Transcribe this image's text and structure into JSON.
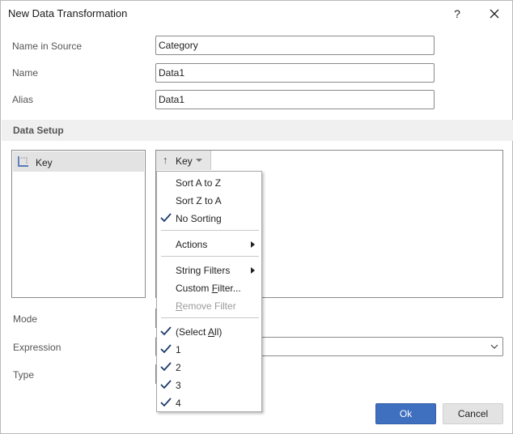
{
  "window": {
    "title": "New Data Transformation",
    "help_glyph": "?"
  },
  "fields": {
    "name_in_source": {
      "label": "Name in Source",
      "value": "Category"
    },
    "name": {
      "label": "Name",
      "value": "Data1"
    },
    "alias": {
      "label": "Alias",
      "value": "Data1"
    }
  },
  "section": {
    "title": "Data Setup"
  },
  "list": {
    "items": [
      {
        "label": "Key",
        "icon": "dimension-icon"
      }
    ]
  },
  "grid": {
    "column_header": "Key",
    "sort_arrow": "↑"
  },
  "menu": {
    "sort_asc": "Sort A to Z",
    "sort_desc": "Sort Z to A",
    "no_sorting": "No Sorting",
    "actions": "Actions",
    "string_filters": "String Filters",
    "custom_filter_pre": "Custom ",
    "custom_filter_u": "F",
    "custom_filter_post": "ilter...",
    "remove_filter_u": "R",
    "remove_filter_post": "emove Filter",
    "select_all_pre": "(Select ",
    "select_all_u": "A",
    "select_all_post": "ll)",
    "values": [
      "1",
      "2",
      "3",
      "4"
    ]
  },
  "lower": {
    "mode_label": "Mode",
    "expression_label": "Expression",
    "type_label": "Type"
  },
  "buttons": {
    "ok": "Ok",
    "cancel": "Cancel"
  },
  "colors": {
    "accent": "#3f6fbf",
    "check": "#1a3a6a"
  }
}
